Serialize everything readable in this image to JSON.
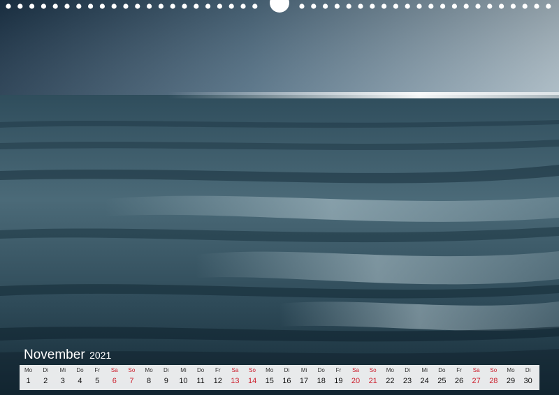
{
  "calendar": {
    "month": "November",
    "year": "2021",
    "days": [
      {
        "abbr": "Mo",
        "num": "1",
        "weekend": false
      },
      {
        "abbr": "Di",
        "num": "2",
        "weekend": false
      },
      {
        "abbr": "Mi",
        "num": "3",
        "weekend": false
      },
      {
        "abbr": "Do",
        "num": "4",
        "weekend": false
      },
      {
        "abbr": "Fr",
        "num": "5",
        "weekend": false
      },
      {
        "abbr": "Sa",
        "num": "6",
        "weekend": true
      },
      {
        "abbr": "So",
        "num": "7",
        "weekend": true
      },
      {
        "abbr": "Mo",
        "num": "8",
        "weekend": false
      },
      {
        "abbr": "Di",
        "num": "9",
        "weekend": false
      },
      {
        "abbr": "Mi",
        "num": "10",
        "weekend": false
      },
      {
        "abbr": "Do",
        "num": "11",
        "weekend": false
      },
      {
        "abbr": "Fr",
        "num": "12",
        "weekend": false
      },
      {
        "abbr": "Sa",
        "num": "13",
        "weekend": true
      },
      {
        "abbr": "So",
        "num": "14",
        "weekend": true
      },
      {
        "abbr": "Mo",
        "num": "15",
        "weekend": false
      },
      {
        "abbr": "Di",
        "num": "16",
        "weekend": false
      },
      {
        "abbr": "Mi",
        "num": "17",
        "weekend": false
      },
      {
        "abbr": "Do",
        "num": "18",
        "weekend": false
      },
      {
        "abbr": "Fr",
        "num": "19",
        "weekend": false
      },
      {
        "abbr": "Sa",
        "num": "20",
        "weekend": true
      },
      {
        "abbr": "So",
        "num": "21",
        "weekend": true
      },
      {
        "abbr": "Mo",
        "num": "22",
        "weekend": false
      },
      {
        "abbr": "Di",
        "num": "23",
        "weekend": false
      },
      {
        "abbr": "Mi",
        "num": "24",
        "weekend": false
      },
      {
        "abbr": "Do",
        "num": "25",
        "weekend": false
      },
      {
        "abbr": "Fr",
        "num": "26",
        "weekend": false
      },
      {
        "abbr": "Sa",
        "num": "27",
        "weekend": true
      },
      {
        "abbr": "So",
        "num": "28",
        "weekend": true
      },
      {
        "abbr": "Mo",
        "num": "29",
        "weekend": false
      },
      {
        "abbr": "Di",
        "num": "30",
        "weekend": false
      }
    ]
  },
  "colors": {
    "weekend": "#cc1e2c",
    "sky_dark": "#1e3a4f",
    "sea": "#3b5b6a"
  }
}
